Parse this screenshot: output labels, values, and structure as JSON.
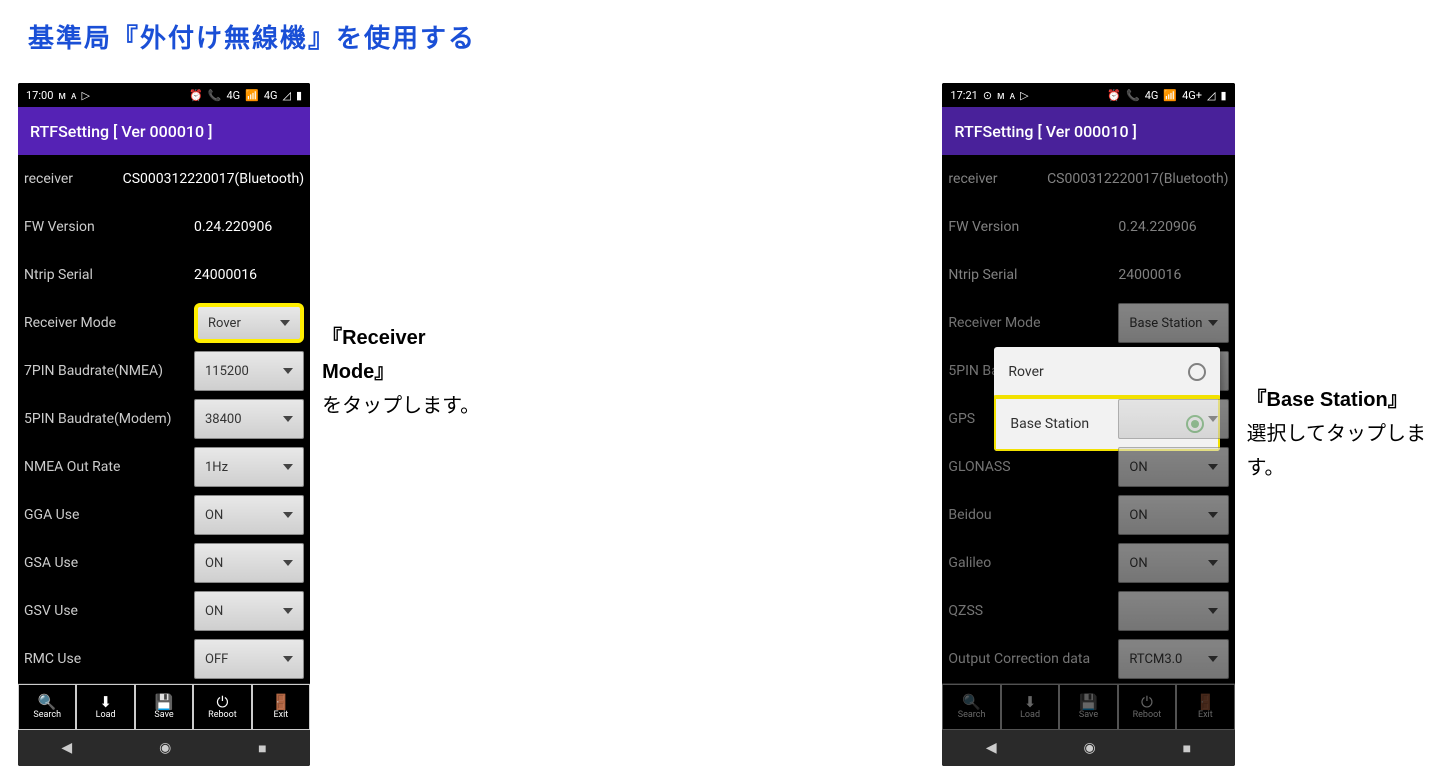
{
  "page": {
    "title": "基準局『外付け無線機』を使用する"
  },
  "annot1": {
    "line1_bold": "『Receiver Mode』",
    "line2": "をタップします。"
  },
  "annot2": {
    "line1_bold": "『Base Station』",
    "line2": "選択してタップします。"
  },
  "icons": {
    "search": "🔍",
    "load": "⬇",
    "save": "💾",
    "reboot": "⏻",
    "exit": "🚪",
    "back": "◀",
    "home": "◉",
    "recent": "■",
    "alarm": "⏰",
    "volte": "📞",
    "sig": "📶",
    "batt": "▮"
  },
  "common": {
    "appbar": "RTFSetting  [ Ver 000010 ]",
    "rows_text": [
      [
        "receiver",
        "CS000312220017(Bluetooth)"
      ],
      [
        "FW Version",
        "0.24.220906"
      ],
      [
        "Ntrip Serial",
        "24000016"
      ]
    ],
    "toolbar": [
      "Search",
      "Load",
      "Save",
      "Reboot",
      "Exit"
    ]
  },
  "phone1": {
    "time": "17:00",
    "dropdowns": [
      {
        "label": "Receiver Mode",
        "value": "Rover",
        "hl": true
      },
      {
        "label": "7PIN Baudrate(NMEA)",
        "value": "115200"
      },
      {
        "label": "5PIN Baudrate(Modem)",
        "value": "38400"
      },
      {
        "label": "NMEA Out Rate",
        "value": "1Hz"
      },
      {
        "label": "GGA Use",
        "value": "ON"
      },
      {
        "label": "GSA Use",
        "value": "ON"
      },
      {
        "label": "GSV Use",
        "value": "ON"
      },
      {
        "label": "RMC Use",
        "value": "OFF"
      }
    ]
  },
  "phone2": {
    "time": "17:21",
    "dropdowns": [
      {
        "label": "Receiver Mode",
        "value": "Base Station"
      },
      {
        "label": "5PIN Ba",
        "value": ""
      },
      {
        "label": "GPS",
        "value": ""
      },
      {
        "label": "GLONASS",
        "value": "ON"
      },
      {
        "label": "Beidou",
        "value": "ON"
      },
      {
        "label": "Galileo",
        "value": "ON"
      },
      {
        "label": "QZSS",
        "value": ""
      },
      {
        "label": "Output Correction data",
        "value": "RTCM3.0"
      }
    ],
    "popup": {
      "opt1": "Rover",
      "opt2": "Base Station"
    }
  }
}
